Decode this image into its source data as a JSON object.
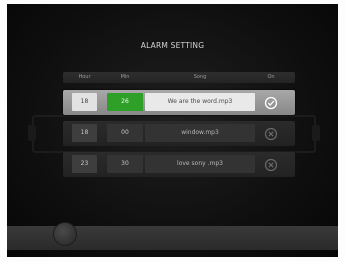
{
  "title": "ALARM SETTING",
  "columns": {
    "hour": "Hour",
    "min": "Min",
    "song": "Song",
    "on": "On"
  },
  "alarms": [
    {
      "hour": "18",
      "min": "26",
      "song": "We are the word.mp3",
      "on": true,
      "on_icon": "check-circle-icon"
    },
    {
      "hour": "18",
      "min": "00",
      "song": "window.mp3",
      "on": false,
      "on_icon": "x-circle-icon"
    },
    {
      "hour": "23",
      "min": "30",
      "song": "love sony .mp3",
      "on": false,
      "on_icon": "x-circle-icon"
    }
  ],
  "colors": {
    "selected_minute": "#2e9f27"
  }
}
